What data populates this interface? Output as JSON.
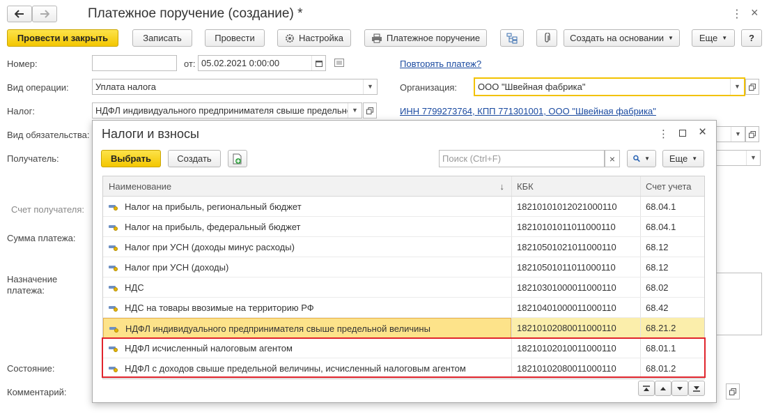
{
  "window": {
    "title": "Платежное поручение (создание) *",
    "back_icon": "arrow-left-icon",
    "forward_icon": "arrow-right-icon"
  },
  "toolbar": {
    "post_close": "Провести и закрыть",
    "save": "Записать",
    "post": "Провести",
    "settings": "Настройка",
    "print_order": "Платежное поручение",
    "create_based": "Создать на основании",
    "more": "Еще",
    "help": "?"
  },
  "form": {
    "number_label": "Номер:",
    "number_value": "",
    "from_label": "от:",
    "date_value": "05.02.2021  0:00:00",
    "repeat_link": "Повторять платеж?",
    "operation_label": "Вид операции:",
    "operation_value": "Уплата налога",
    "org_label": "Организация:",
    "org_value": "ООО \"Швейная фабрика\"",
    "tax_label": "Налог:",
    "tax_value": "НДФЛ индивидуального предпринимателя свыше предельной величины",
    "inn_link": "ИНН 7799273764, КПП 771301001, ООО \"Швейная фабрика\"",
    "obligation_label": "Вид обязательства:",
    "recipient_label": "Получатель:",
    "recipient_account_label": "Счет получателя:",
    "amount_label": "Сумма платежа:",
    "purpose_label": "Назначение платежа:",
    "state_label": "Состояние:",
    "comment_label": "Комментарий:"
  },
  "dialog": {
    "title": "Налоги и взносы",
    "select": "Выбрать",
    "create": "Создать",
    "search_placeholder": "Поиск (Ctrl+F)",
    "search_clear": "×",
    "more": "Еще",
    "columns": {
      "name": "Наименование",
      "sort_indicator": "↓",
      "kbk": "КБК",
      "account": "Счет учета"
    },
    "rows": [
      {
        "name": "Налог на прибыль, региональный бюджет",
        "kbk": "18210101012021000110",
        "account": "68.04.1"
      },
      {
        "name": "Налог на прибыль, федеральный бюджет",
        "kbk": "18210101011011000110",
        "account": "68.04.1"
      },
      {
        "name": "Налог при УСН (доходы минус расходы)",
        "kbk": "18210501021011000110",
        "account": "68.12"
      },
      {
        "name": "Налог при УСН (доходы)",
        "kbk": "18210501011011000110",
        "account": "68.12"
      },
      {
        "name": "НДС",
        "kbk": "18210301000011000110",
        "account": "68.02"
      },
      {
        "name": "НДС на товары ввозимые на территорию РФ",
        "kbk": "18210401000011000110",
        "account": "68.42"
      },
      {
        "name": "НДФЛ индивидуального предпринимателя свыше предельной величины",
        "kbk": "18210102080011000110",
        "account": "68.21.2"
      },
      {
        "name": "НДФЛ исчисленный налоговым агентом",
        "kbk": "18210102010011000110",
        "account": "68.01.1"
      },
      {
        "name": "НДФЛ с доходов свыше предельной величины, исчисленный налоговым агентом",
        "kbk": "18210102080011000110",
        "account": "68.01.2"
      }
    ]
  }
}
